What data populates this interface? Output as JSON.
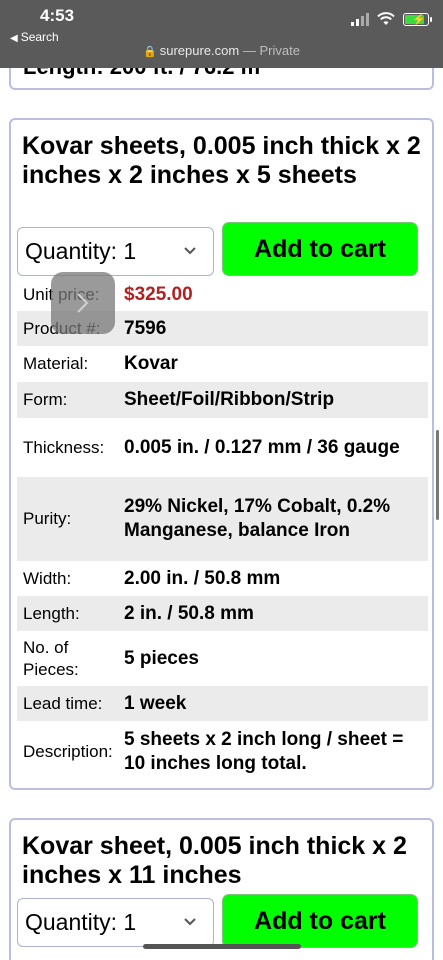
{
  "status_bar": {
    "time": "4:53",
    "back_label": "Search",
    "url_host": "surepure.com",
    "url_suffix": "— Private"
  },
  "products": [
    {
      "title": "Kovar sheets, 0.005 inch thick x 2 inches x 2 inches x 5 sheets",
      "quantity_label": "Quantity: 1",
      "add_to_cart_label": "Add to cart",
      "specs": [
        {
          "label": "Unit price:",
          "value": "$325.00"
        },
        {
          "label": "Product #:",
          "value": "7596"
        },
        {
          "label": "Material:",
          "value": "Kovar"
        },
        {
          "label": "Form:",
          "value": "Sheet/Foil/Ribbon/Strip"
        },
        {
          "label": "Thickness:",
          "value": "0.005 in. / 0.127 mm / 36 gauge"
        },
        {
          "label": "Purity:",
          "value": "29% Nickel, 17% Cobalt, 0.2% Manganese, balance Iron"
        },
        {
          "label": "Width:",
          "value": "2.00 in. / 50.8 mm"
        },
        {
          "label": "Length:",
          "value": "2 in. / 50.8 mm"
        },
        {
          "label": "No. of Pieces:",
          "value": "5 pieces"
        },
        {
          "label": "Lead time:",
          "value": "1 week"
        },
        {
          "label": "Description:",
          "value": "5 sheets x 2 inch long / sheet = 10 inches long total."
        }
      ]
    },
    {
      "title": "Kovar sheet, 0.005 inch thick x 2 inches x 11 inches",
      "quantity_label": "Quantity: 1",
      "add_to_cart_label": "Add to cart"
    }
  ],
  "previous_card_partial": "Length: 200 ft. / 76.2 m",
  "colors": {
    "price": "#b22222",
    "add_to_cart_bg": "#00ff00",
    "card_border": "#b8bfe0",
    "alt_row": "#ebebeb"
  }
}
